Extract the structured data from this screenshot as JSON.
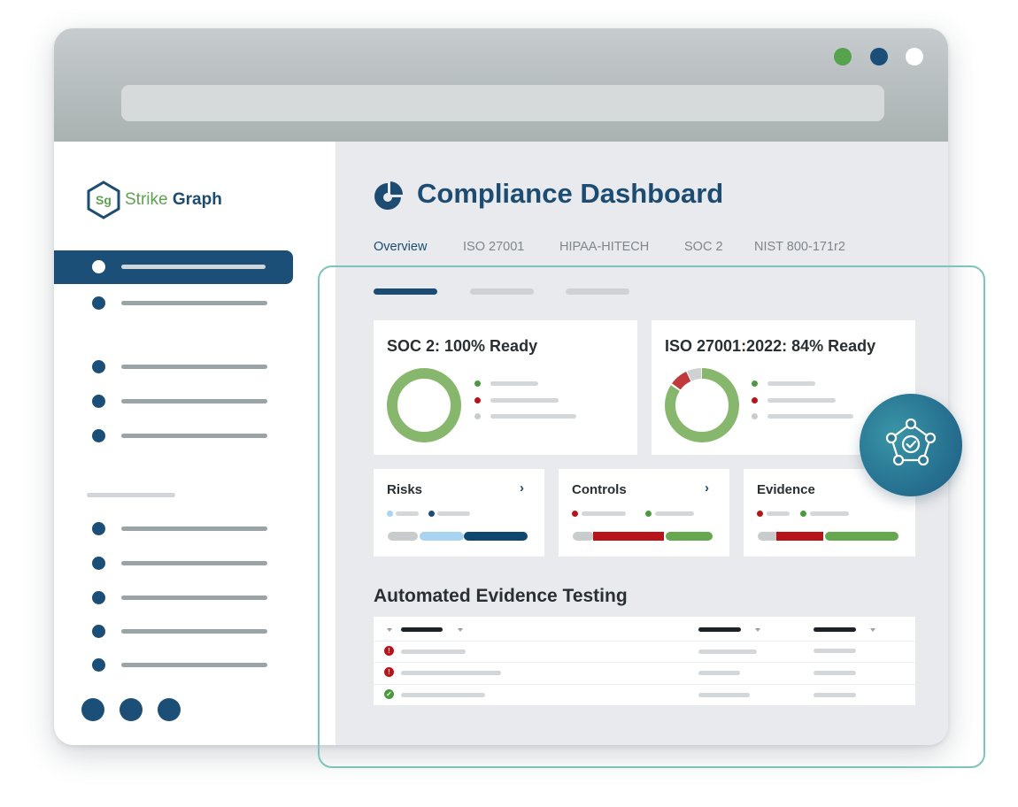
{
  "app": {
    "brand_prefix": "Strike",
    "brand_suffix": "Graph",
    "logo_initials": "Sg"
  },
  "page": {
    "title": "Compliance Dashboard"
  },
  "tabs": [
    {
      "label": "Overview",
      "active": true
    },
    {
      "label": "ISO 27001",
      "active": false
    },
    {
      "label": "HIPAA-HITECH",
      "active": false
    },
    {
      "label": "SOC 2",
      "active": false
    },
    {
      "label": "NIST 800-171r2",
      "active": false
    }
  ],
  "readiness": [
    {
      "title": "SOC 2: 100% Ready",
      "percent": 100
    },
    {
      "title": "ISO 27001:2022: 84% Ready",
      "percent": 84
    }
  ],
  "summary_cards": [
    {
      "title": "Risks",
      "has_chevron": true
    },
    {
      "title": "Controls",
      "has_chevron": true
    },
    {
      "title": "Evidence",
      "has_chevron": false
    }
  ],
  "section": {
    "title": "Automated Evidence Testing"
  },
  "table": {
    "rows": [
      {
        "status": "fail",
        "icon": "!"
      },
      {
        "status": "fail",
        "icon": "!"
      },
      {
        "status": "pass",
        "icon": "✓"
      }
    ]
  },
  "colors": {
    "brand_navy": "#1c4c72",
    "brand_green": "#5ea24f",
    "success": "#65a84f",
    "danger": "#b81419",
    "neutral": "#c9cccd",
    "light_blue": "#a8d4f2",
    "teal_outline": "#7cc4bd"
  },
  "icons": {
    "logo": "hexagon-logo-icon",
    "dashboard": "pie-chart-icon",
    "badge": "network-check-icon"
  }
}
